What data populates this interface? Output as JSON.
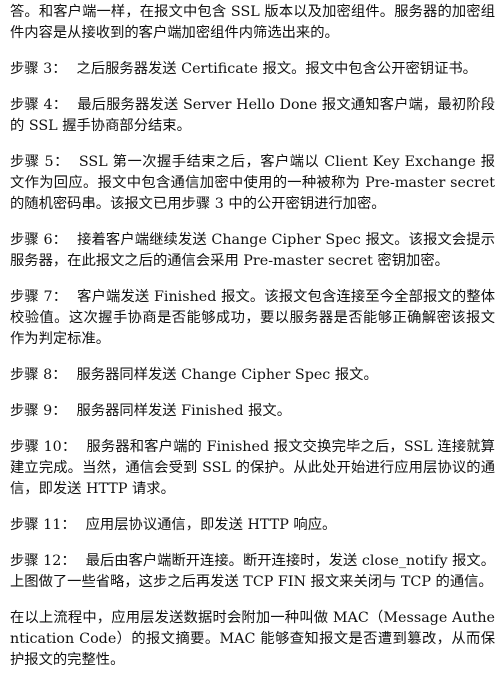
{
  "document": {
    "intro": "答。和客户端一样，在报文中包含 SSL 版本以及加密组件。服务器的加密组件内容是从接收到的客户端加密组件内筛选出来的。",
    "steps": [
      {
        "label": "步骤 3：",
        "text": "之后服务器发送 Certificate 报文。报文中包含公开密钥证书。"
      },
      {
        "label": "步骤 4：",
        "text": "最后服务器发送 Server Hello Done 报文通知客户端，最初阶段的 SSL 握手协商部分结束。"
      },
      {
        "label": "步骤 5：",
        "text": "SSL 第一次握手结束之后，客户端以 Client Key Exchange 报文作为回应。报文中包含通信加密中使用的一种被称为 Pre-master secret 的随机密码串。该报文已用步骤 3 中的公开密钥进行加密。"
      },
      {
        "label": "步骤 6：",
        "text": "接着客户端继续发送 Change Cipher Spec 报文。该报文会提示服务器，在此报文之后的通信会采用 Pre-master secret 密钥加密。"
      },
      {
        "label": "步骤 7：",
        "text": "客户端发送 Finished 报文。该报文包含连接至今全部报文的整体校验值。这次握手协商是否能够成功，要以服务器是否能够正确解密该报文作为判定标准。"
      },
      {
        "label": "步骤 8：",
        "text": "服务器同样发送 Change Cipher Spec 报文。"
      },
      {
        "label": "步骤 9：",
        "text": "服务器同样发送 Finished 报文。"
      },
      {
        "label": "步骤 10：",
        "text": "服务器和客户端的 Finished 报文交换完毕之后，SSL 连接就算建立完成。当然，通信会受到 SSL 的保护。从此处开始进行应用层协议的通信，即发送 HTTP 请求。"
      },
      {
        "label": "步骤 11：",
        "text": "应用层协议通信，即发送 HTTP 响应。"
      },
      {
        "label": "步骤 12：",
        "text": "最后由客户端断开连接。断开连接时，发送 close_notify 报文。上图做了一些省略，这步之后再发送 TCP FIN 报文来关闭与 TCP 的通信。"
      }
    ],
    "closing": "在以上流程中，应用层发送数据时会附加一种叫做 MAC（Message Authentication Code）的报文摘要。MAC 能够查知报文是否遭到篡改，从而保护报文的完整性。"
  }
}
